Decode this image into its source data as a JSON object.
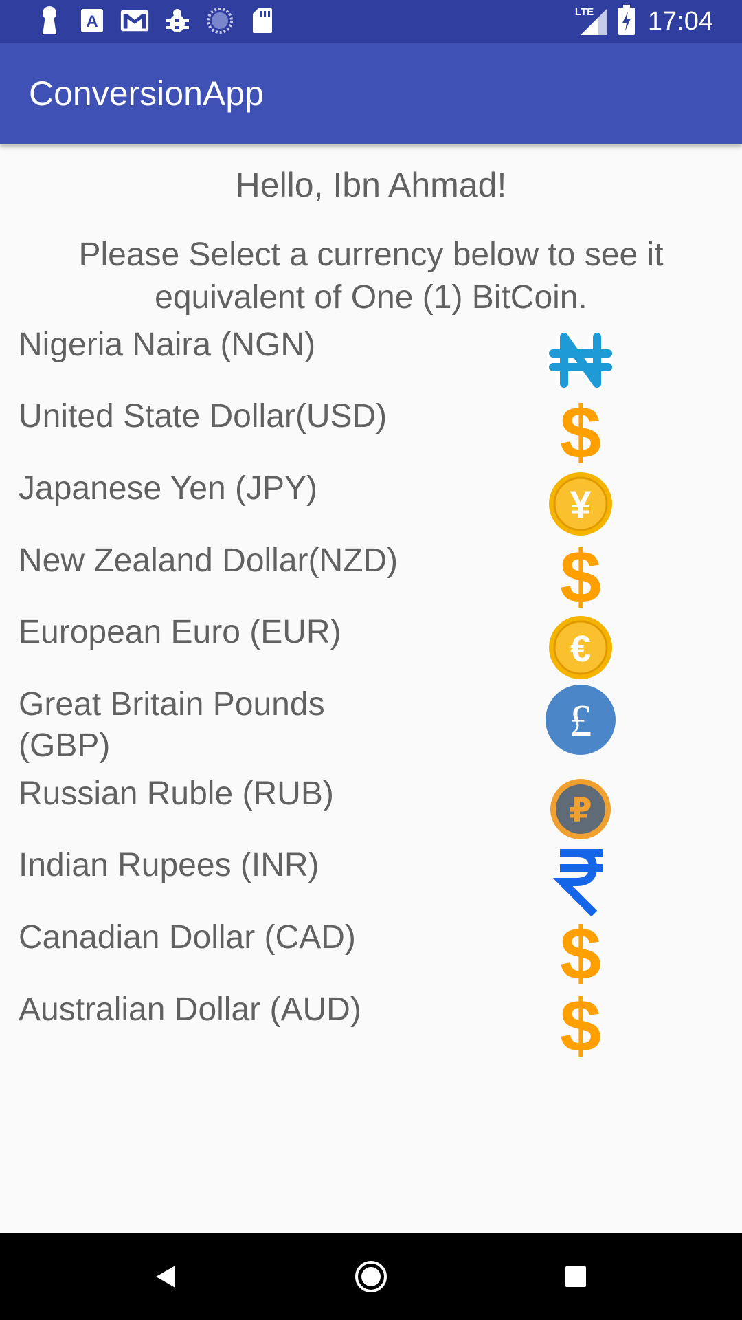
{
  "status_bar": {
    "time": "17:04",
    "network_label": "LTE",
    "left_icons": [
      "keyhole-icon",
      "a-notification-icon",
      "gmail-icon",
      "bug-icon",
      "sync-spinner-icon",
      "sd-card-icon"
    ],
    "right_icons": [
      "signal-icon",
      "battery-charging-icon"
    ]
  },
  "app_bar": {
    "title": "ConversionApp"
  },
  "main": {
    "greeting": "Hello, Ibn Ahmad!",
    "instruction": "Please Select a currency below to see it equivalent of One (1) BitCoin.",
    "currencies": [
      {
        "label": "Nigeria Naira (NGN)",
        "icon": "naira-icon"
      },
      {
        "label": "United State Dollar(USD)",
        "icon": "dollar-icon"
      },
      {
        "label": "Japanese Yen (JPY)",
        "icon": "yen-coin-icon"
      },
      {
        "label": "New Zealand Dollar(NZD)",
        "icon": "dollar-icon"
      },
      {
        "label": "European Euro  (EUR)",
        "icon": "euro-coin-icon"
      },
      {
        "label": "Great Britain Pounds (GBP)",
        "icon": "pound-icon"
      },
      {
        "label": "Russian Ruble (RUB)",
        "icon": "ruble-coin-icon"
      },
      {
        "label": "Indian Rupees (INR)",
        "icon": "rupee-icon"
      },
      {
        "label": "Canadian Dollar (CAD)",
        "icon": "dollar-icon"
      },
      {
        "label": "Australian Dollar (AUD)",
        "icon": "dollar-icon"
      }
    ]
  },
  "nav_bar": {
    "buttons": [
      "back-icon",
      "home-icon",
      "recents-icon"
    ]
  },
  "colors": {
    "status_bar": "#303f9f",
    "app_bar": "#3f51b5",
    "text": "#616161",
    "dollar": "#ffa000",
    "naira": "#1e9ad6",
    "gold": "#f4b400",
    "pound": "#4a86c8",
    "rupee": "#1565e8"
  }
}
